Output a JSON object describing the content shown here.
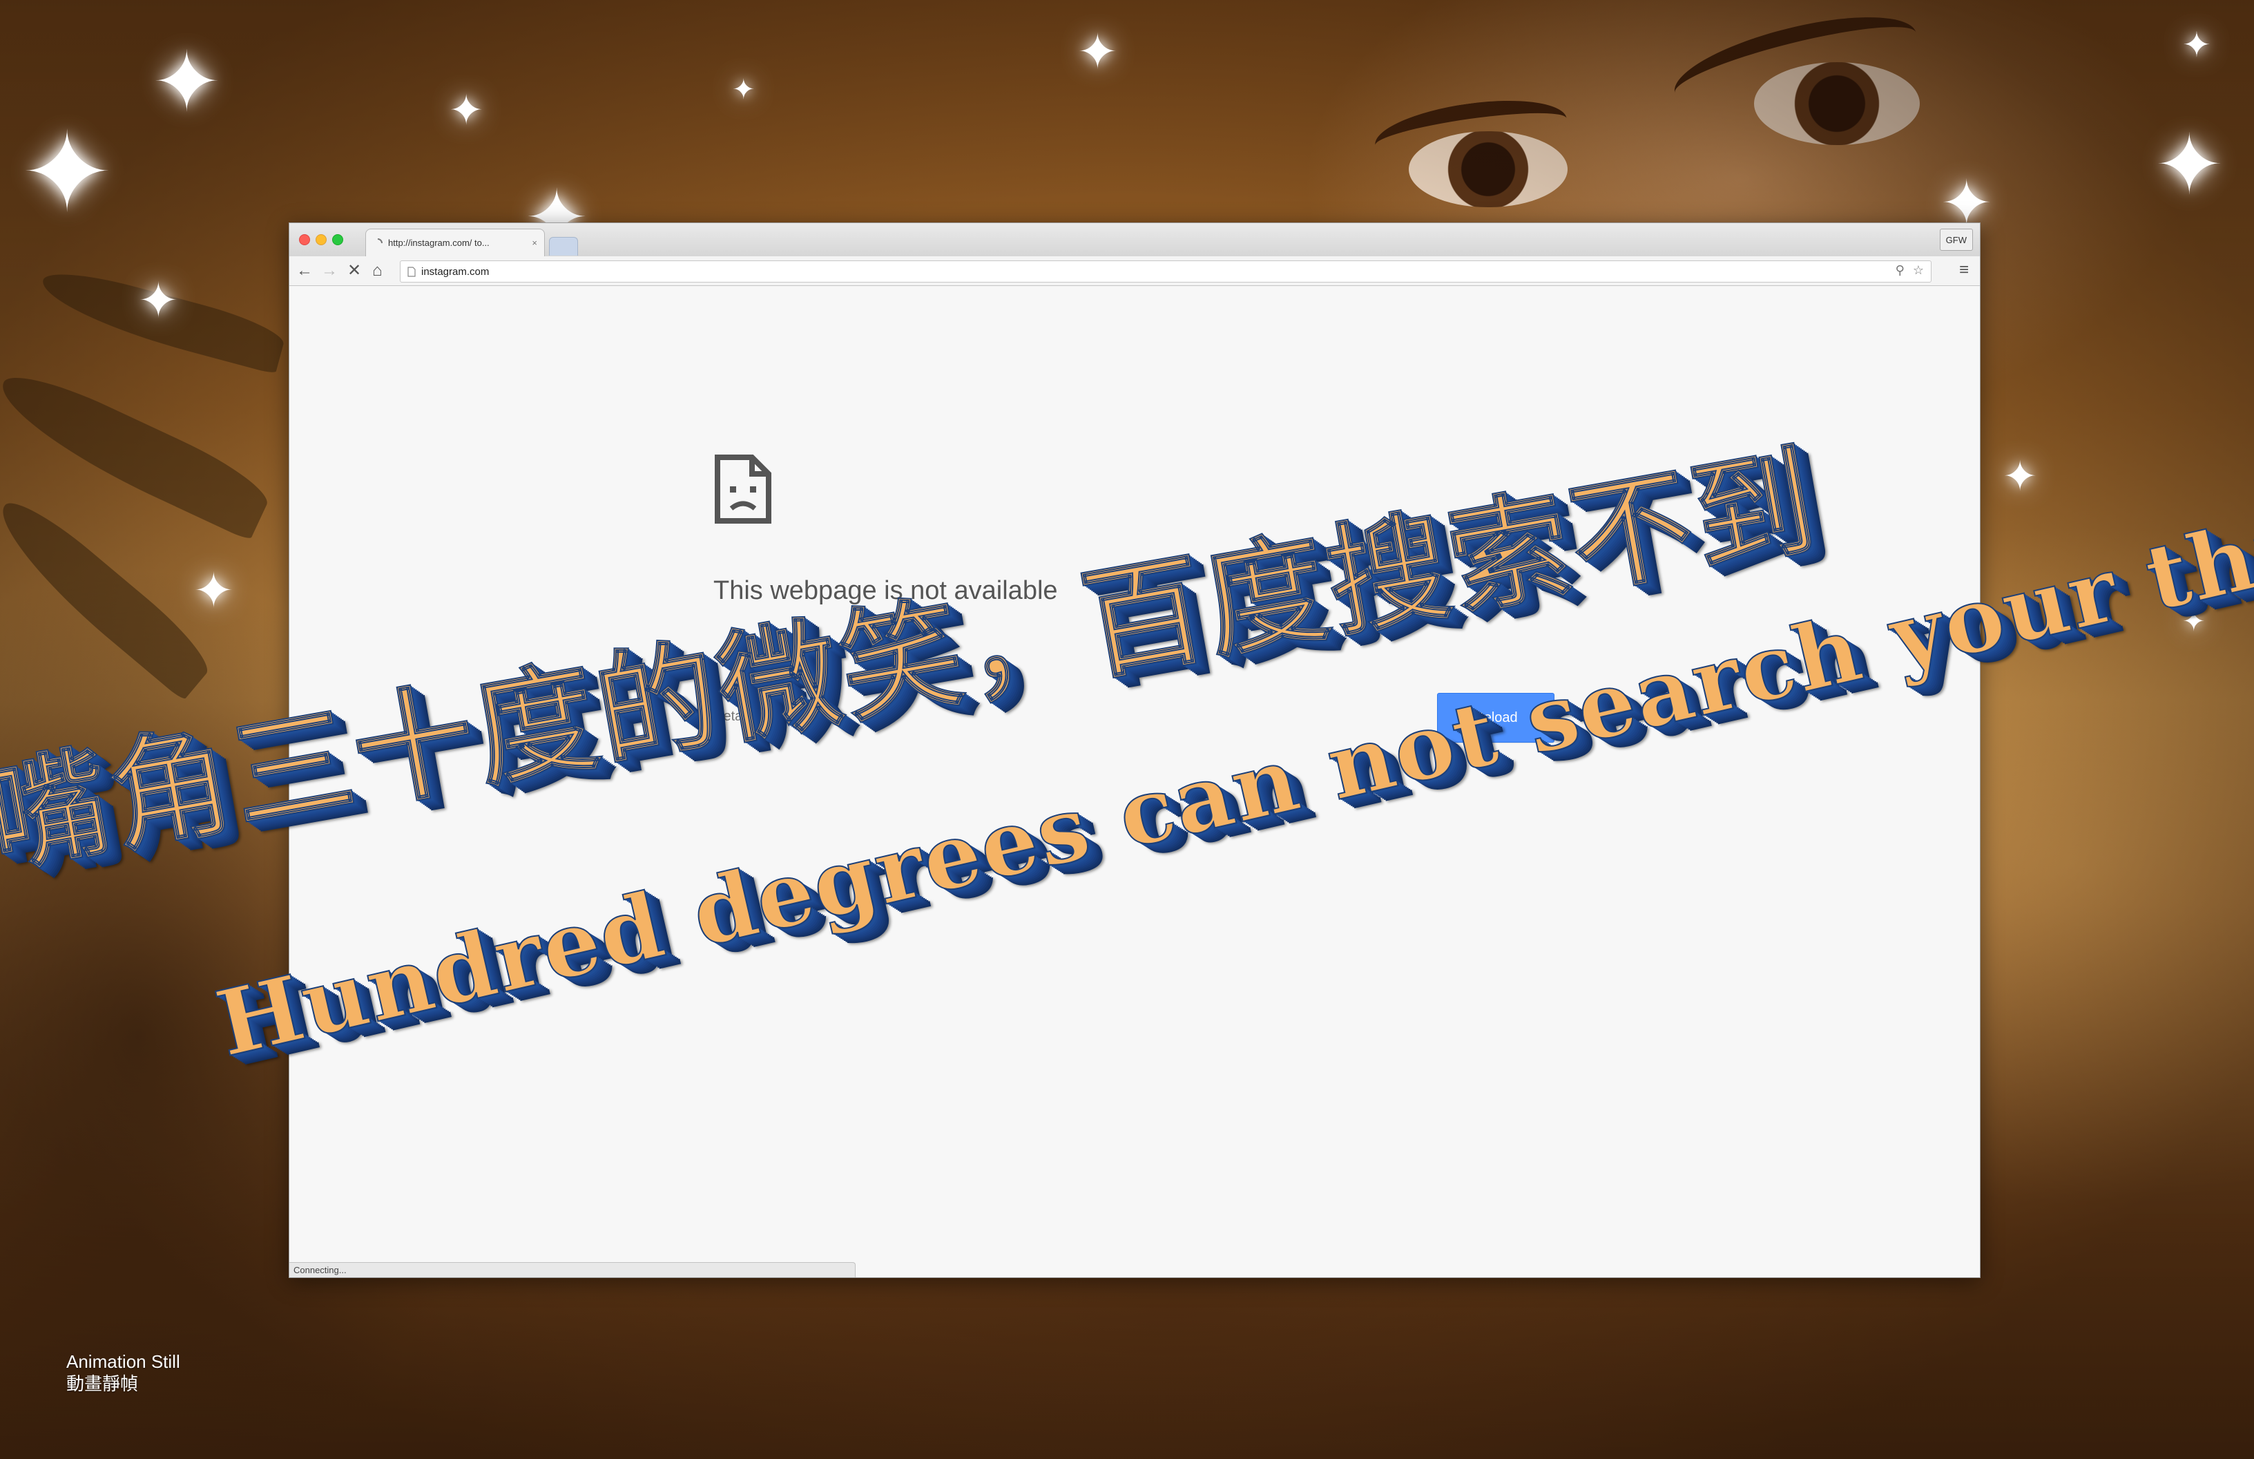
{
  "browser": {
    "tab_title": "http://instagram.com/ to...",
    "tab_close": "×",
    "extension_badge": "GFW",
    "url": "instagram.com",
    "status_text": "Connecting..."
  },
  "error_page": {
    "title": "This webpage is not available",
    "details_label": "Details",
    "reload_label": "Reload"
  },
  "overlay_text": {
    "chinese_line": "嘴角三十度的微笑，百度搜索不到",
    "english_line": "Hundred degrees can not search your thirty degree s"
  },
  "caption": {
    "line1": "Animation Still",
    "line2": "動畫靜幀"
  },
  "colors": {
    "reload_button": "#4d90fe",
    "text_face": "#f5b365",
    "text_extrusion": "#1f4d96"
  },
  "icons": [
    "back-icon",
    "forward-icon",
    "stop-icon",
    "home-icon",
    "page-icon",
    "zoom-icon",
    "star-icon",
    "menu-icon",
    "sad-file-icon",
    "sparkle-icon"
  ]
}
